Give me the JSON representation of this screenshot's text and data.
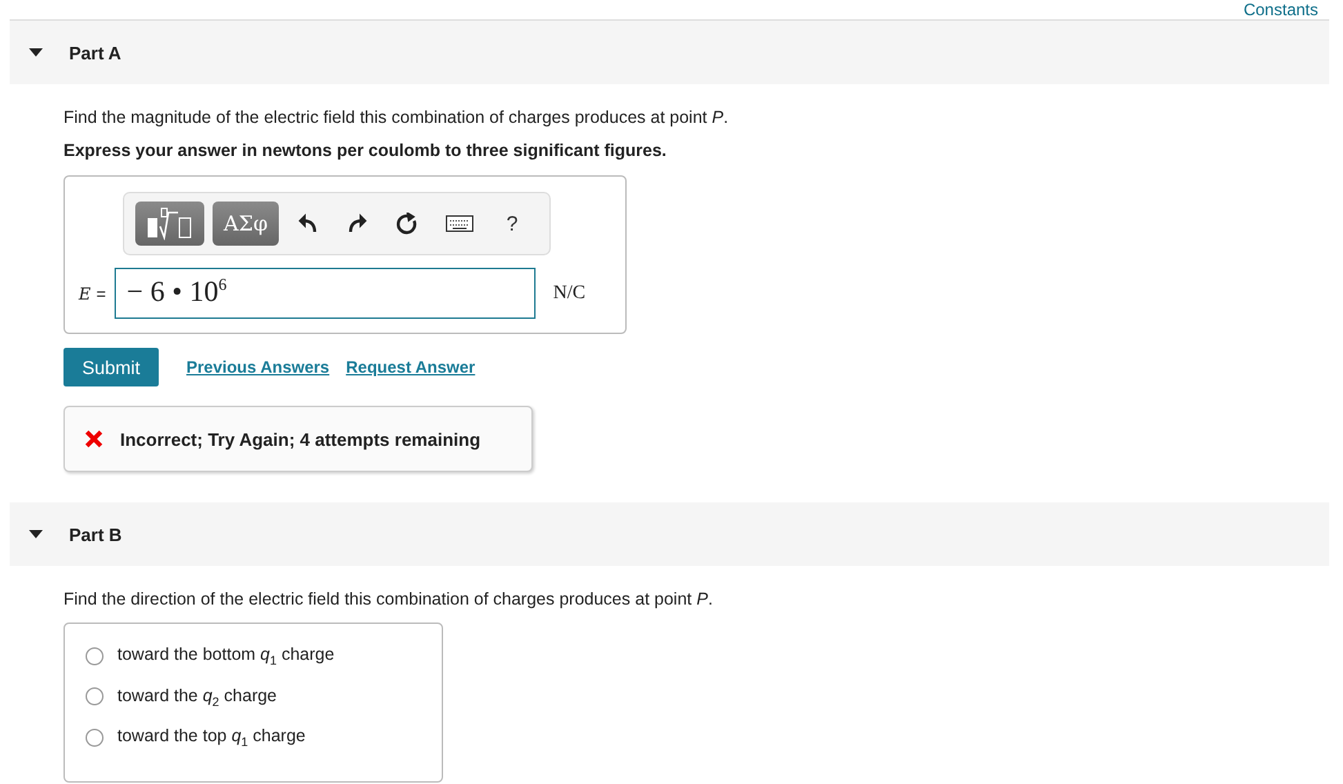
{
  "header_link": "Constants",
  "part_a": {
    "title": "Part A",
    "expanded": true,
    "question": "Find the magnitude of the electric field this combination of charges produces at point *P*.",
    "instruction": "Express your answer in newtons per coulomb to three significant figures.",
    "toolbar": [
      {
        "kind": "template"
      },
      {
        "kind": "text",
        "label": "ΑΣφ"
      },
      {
        "kind": "undo"
      },
      {
        "kind": "redo"
      },
      {
        "kind": "reset"
      },
      {
        "kind": "keyboard"
      },
      {
        "kind": "help",
        "label": "?"
      }
    ],
    "variable": "E",
    "equals": "=",
    "answer": "− 6 • 10$^{6}$",
    "unit": "N/C",
    "submit": "Submit",
    "links": [
      "Previous Answers",
      "Request Answer"
    ],
    "feedback": {
      "correct": false,
      "message": "Incorrect; Try Again; 4 attempts remaining"
    }
  },
  "part_b": {
    "title": "Part B",
    "expanded": true,
    "question": "Find the direction of the electric field this combination of charges produces at point *P*.",
    "options": [
      {
        "label": "toward the bottom *q*$_{1}$ charge",
        "selected": false
      },
      {
        "label": "toward the *q*$_{2}$ charge",
        "selected": false
      },
      {
        "label": "toward the top *q*$_{1}$ charge",
        "selected": false
      }
    ]
  }
}
